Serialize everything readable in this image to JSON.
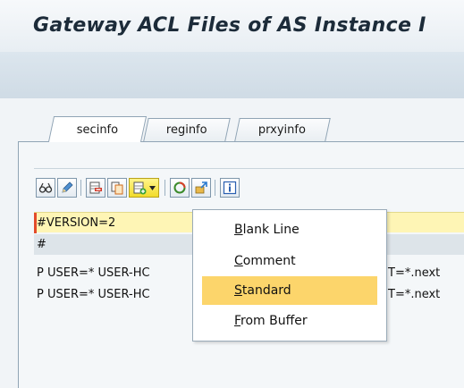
{
  "title": "Gateway ACL Files of AS Instance I",
  "tabs": [
    {
      "label": "secinfo",
      "active": true
    },
    {
      "label": "reginfo",
      "active": false
    },
    {
      "label": "prxyinfo",
      "active": false
    }
  ],
  "toolbar": {
    "icons": [
      "glasses-icon",
      "pencil-icon",
      "delete-row-icon",
      "copy-row-icon",
      "insert-row-icon",
      "dropdown-arrow-icon",
      "refresh-icon",
      "import-icon",
      "info-icon"
    ]
  },
  "rows": [
    {
      "text": "#VERSION=2",
      "right": ""
    },
    {
      "text": "#",
      "right": ""
    },
    {
      "text": "P USER=* USER-HC",
      "right": "T=*.next"
    },
    {
      "text": "P USER=* USER-HC",
      "right": "T=*.next"
    }
  ],
  "menu": {
    "items": [
      {
        "first": "B",
        "rest": "lank Line",
        "selected": false
      },
      {
        "first": "C",
        "rest": "omment",
        "selected": false
      },
      {
        "first": "S",
        "rest": "tandard",
        "selected": true
      },
      {
        "first": "F",
        "rest": "rom Buffer",
        "selected": false
      }
    ]
  },
  "colors": {
    "highlight_row": "#fef5b5",
    "menu_selection": "#fcd56b",
    "accent_red": "#e24b2b"
  }
}
